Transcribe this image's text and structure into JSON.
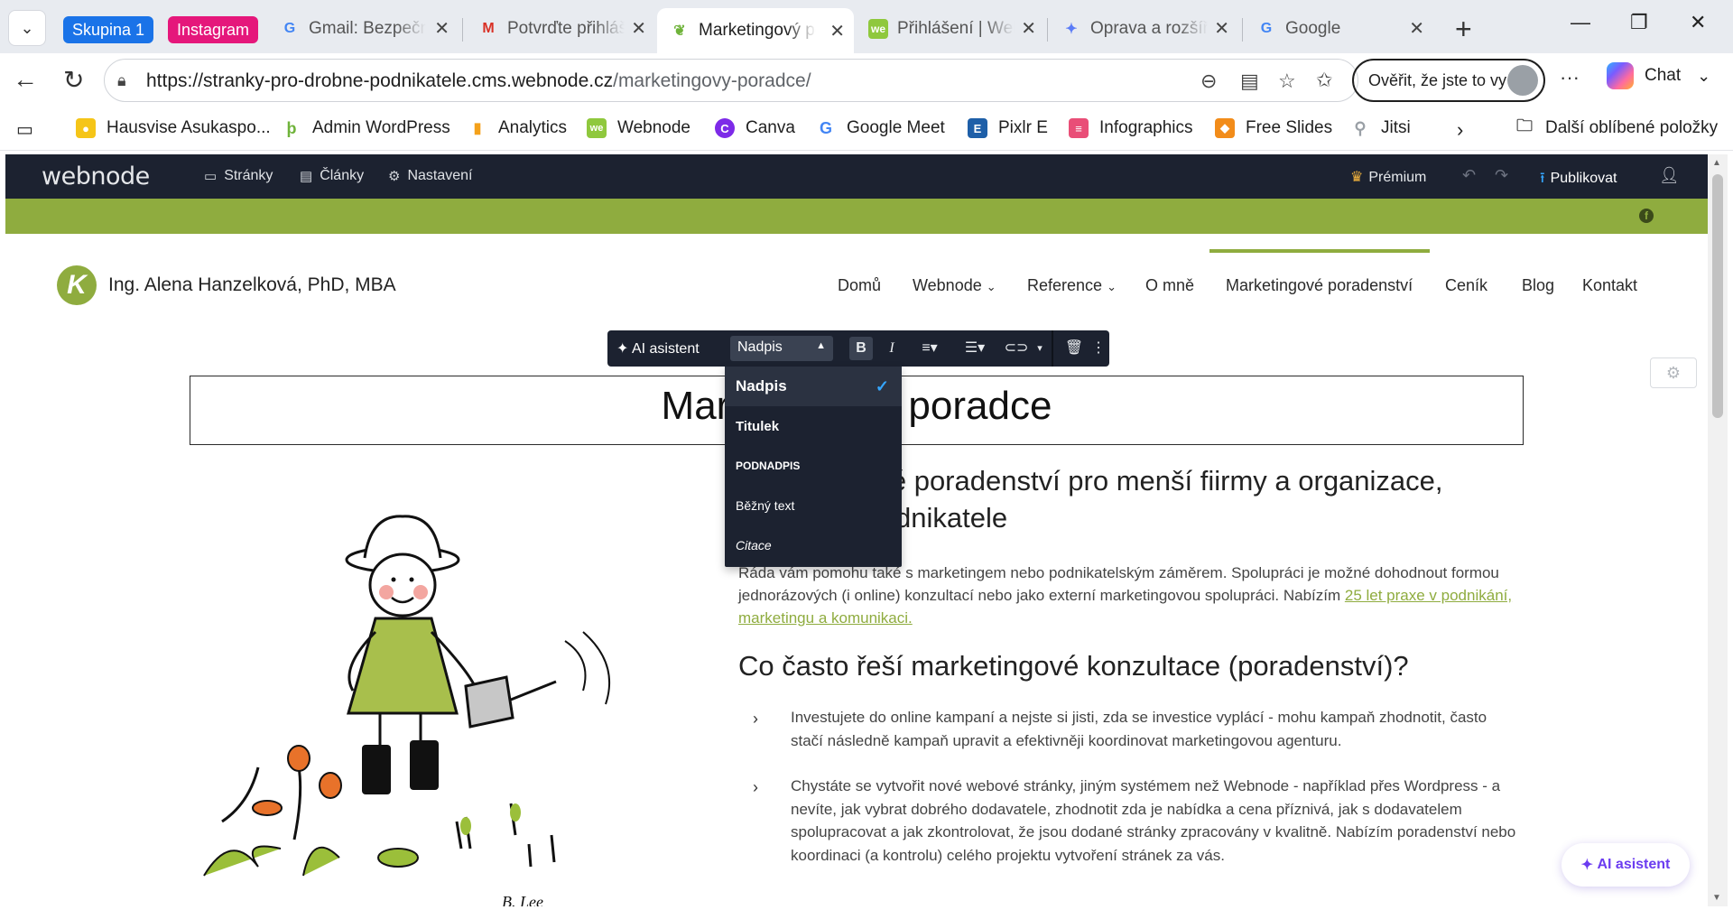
{
  "browser": {
    "groups": [
      {
        "label": "Skupina 1",
        "color": "#1a73e8"
      },
      {
        "label": "Instagram",
        "color": "#e5177b"
      }
    ],
    "tabs": [
      {
        "title": "Gmail: Bezpečný",
        "icon": "google-icon"
      },
      {
        "title": "Potvrďte přihlášení",
        "icon": "gmail-icon"
      },
      {
        "title": "Marketingový poradce",
        "icon": "leaf-icon",
        "active": true
      },
      {
        "title": "Přihlášení | Webnode",
        "icon": "webnode-icon"
      },
      {
        "title": "Oprava a rozšíření",
        "icon": "gemini-icon"
      },
      {
        "title": "Google",
        "icon": "google-icon"
      }
    ],
    "url_host": "https://stranky-pro-drobne-podnikatele.cms.webnode.cz",
    "url_path": "/marketingovy-poradce/",
    "verify_label": "Ověřit, že jste to vy",
    "chat_label": "Chat"
  },
  "bookmarks": [
    {
      "label": "Hausvise Asukaspo...",
      "icon": "sun-icon",
      "color": "#f5c518"
    },
    {
      "label": "Admin WordPress",
      "icon": "leaf-link-icon",
      "color": "#6fb33a"
    },
    {
      "label": "Analytics",
      "icon": "analytics-icon",
      "color": "#f4a11a"
    },
    {
      "label": "Webnode",
      "icon": "webnode-icon",
      "color": "#8fc83d"
    },
    {
      "label": "Canva",
      "icon": "canva-icon",
      "color": "#7d2ae8"
    },
    {
      "label": "Google Meet",
      "icon": "google-icon",
      "color": "#4285f4"
    },
    {
      "label": "Pixlr E",
      "icon": "pixlr-icon",
      "color": "#1e5fa8"
    },
    {
      "label": "Infographics",
      "icon": "infographics-icon",
      "color": "#e94e77"
    },
    {
      "label": "Free Slides",
      "icon": "slides-icon",
      "color": "#f28c1a"
    },
    {
      "label": "Jitsi",
      "icon": "jitsi-icon",
      "color": "#9aa0a6"
    },
    {
      "label": "Další oblíbené položky",
      "icon": "folder-icon",
      "color": "#444444"
    }
  ],
  "webnode": {
    "logo": "webnode",
    "menu": [
      "Stránky",
      "Články",
      "Nastavení"
    ],
    "premium": "Prémium",
    "publish": "Publikovat"
  },
  "site": {
    "name": "Ing. Alena Hanzelková, PhD, MBA",
    "nav": [
      "Domů",
      "Webnode",
      "Reference",
      "O mně",
      "Marketingové poradenství",
      "Ceník",
      "Blog",
      "Kontakt"
    ],
    "heading": "Marketingový poradce",
    "intro": "Marketingové poradenství pro menší fiirmy a organizace, začínající podnikatele",
    "para_text": "Ráda vám pomohu také s marketingem nebo podnikatelským záměrem. Spolupráci je možné dohodnout formou jednorázových (i online) konzultací nebo jako externí marketingovou spolupráci. Nabízím ",
    "para_link": "25 let praxe v podnikání, marketingu a komunikaci.",
    "h2": "Co často řeší marketingové konzultace (poradenství)?",
    "list": [
      "Investujete do online kampaní a nejste si jisti, zda se investice vyplácí - mohu kampaň zhodnotit, často stačí následně kampaň upravit a efektivněji koordinovat marketingovou agenturu.",
      "Chystáte se vytvořit nové webové stránky, jiným systémem než Webnode - například přes Wordpress - a nevíte, jak vybrat dobrého dodavatele, zhodnotit zda je nabídka a cena příznivá, jak s dodavatelem spolupracovat a jak zkontrolovat, že jsou dodané stránky zpracovány v kvalitně. Nabízím poradenství nebo koordinaci (a kontrolu) celého projektu vytvoření stránek za vás."
    ],
    "signature": "B. Lee"
  },
  "editor": {
    "ai_label": "AI asistent",
    "style_selected": "Nadpis",
    "style_options": [
      "Nadpis",
      "Titulek",
      "PODNADPIS",
      "Běžný text",
      "Citace"
    ],
    "ai_float": "AI asistent"
  }
}
